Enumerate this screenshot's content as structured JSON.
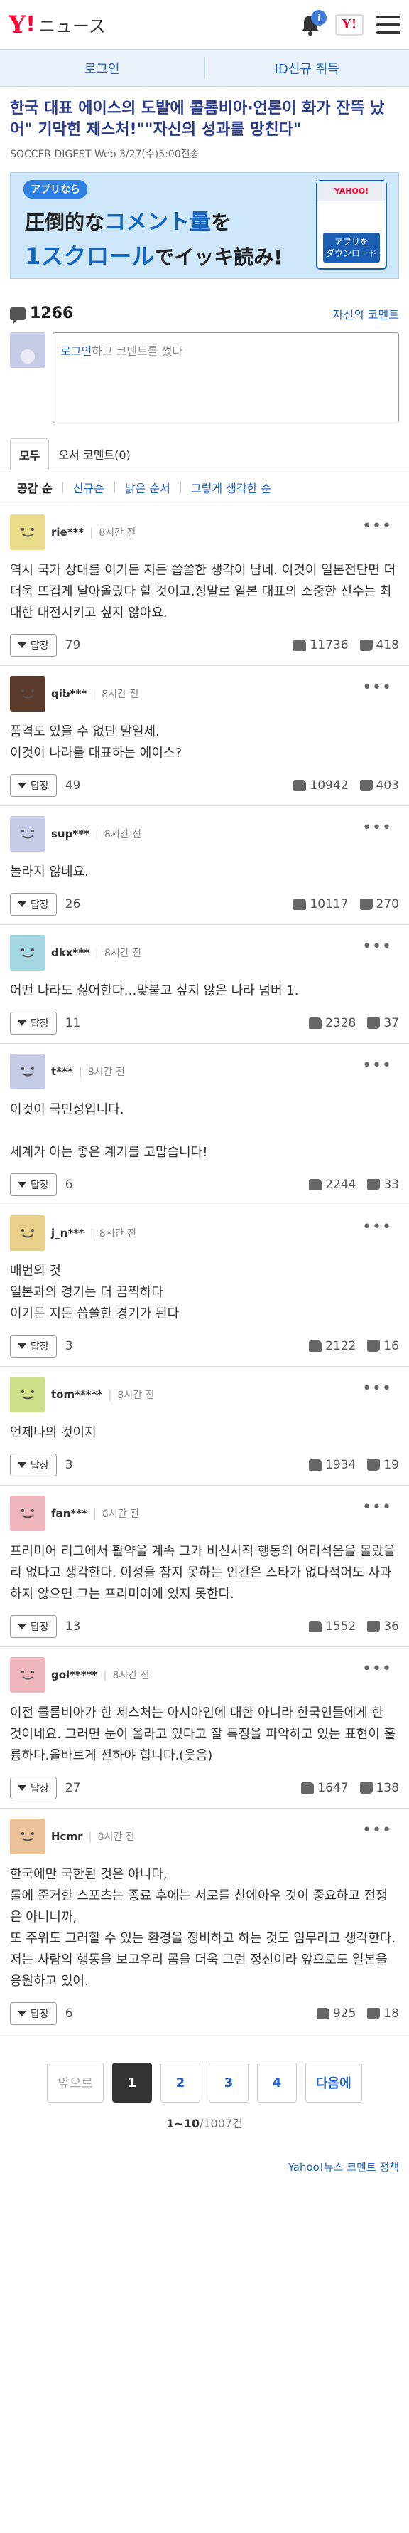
{
  "header": {
    "logo_y": "Y",
    "logo_bang": "!",
    "logo_text": "ニュース",
    "badge": "i",
    "ylogo": "Y!"
  },
  "login_bar": {
    "login": "로그인",
    "signup": "ID신규 취득"
  },
  "article": {
    "title": "한국 대표 에이스의 도발에 콜롬비아·언론이 화가 잔뜩 났어\" 기막힌 제스처!\"\"자신의 성과를 망친다\"",
    "meta": "SOCCER DIGEST Web  3/27(수)5:00전송"
  },
  "banner": {
    "tag": "アプリなら",
    "line1_a": "圧倒的な",
    "line1_b": "コメント量",
    "line1_c": "を",
    "line2_a": "1スクロール",
    "line2_b": "でイッキ読み!",
    "app_button": "アプリを\nダウンロード",
    "app_logo": "YAHOO!"
  },
  "comments_header": {
    "count": "1266",
    "my_comments": "자신의 코멘트"
  },
  "compose": {
    "login_link": "로그인",
    "rest": "하고 코멘트를 썼다"
  },
  "tabs": {
    "all": "모두",
    "expert": "오서 코멘트(0)"
  },
  "sorts": [
    "공감 순",
    "신규순",
    "낡은 순서",
    "그렇게 생각한 순"
  ],
  "reply_label": "답장",
  "comments": [
    {
      "user": "rie***",
      "time": "8시간 전",
      "body": "역시 국가 상대를 이기든 지든 씁쓸한 생각이 남네. 이것이 일본전단면 더더욱 뜨겁게 달아올랐다 할 것이고.정말로 일본 대표의 소중한 선수는 최대한 대전시키고 싶지 않아요.",
      "replies": "79",
      "up": "11736",
      "down": "418",
      "avatar_color": "#e9dc8a"
    },
    {
      "user": "qib***",
      "time": "8시간 전",
      "body": "품격도 있을 수 없단 말일세.\n이것이 나라를 대표하는 에이스?",
      "replies": "49",
      "up": "10942",
      "down": "403",
      "avatar_color": "#5a3a2a"
    },
    {
      "user": "sup***",
      "time": "8시간 전",
      "body": "놀라지 않네요.",
      "replies": "26",
      "up": "10117",
      "down": "270",
      "avatar_color": "#c6cbe6"
    },
    {
      "user": "dkx***",
      "time": "8시간 전",
      "body": "어떤 나라도 싫어한다…맞붙고 싶지 않은 나라 넘버 1.",
      "replies": "11",
      "up": "2328",
      "down": "37",
      "avatar_color": "#a6d8e4"
    },
    {
      "user": "t***",
      "time": "8시간 전",
      "body": "이것이 국민성입니다.\n\n세계가 아는 좋은 계기를 고맙습니다!",
      "replies": "6",
      "up": "2244",
      "down": "33",
      "avatar_color": "#c6cbe6"
    },
    {
      "user": "j_n***",
      "time": "8시간 전",
      "body": "매번의 것\n일본과의 경기는 더 끔찍하다\n이기든 지든 씁쓸한 경기가 된다",
      "replies": "3",
      "up": "2122",
      "down": "16",
      "avatar_color": "#e9d08a"
    },
    {
      "user": "tom*****",
      "time": "8시간 전",
      "body": "언제나의 것이지",
      "replies": "3",
      "up": "1934",
      "down": "19",
      "avatar_color": "#cde08a"
    },
    {
      "user": "fan***",
      "time": "8시간 전",
      "body": "프리미어 리그에서 활약을 계속 그가 비신사적 행동의 어리석음을 몰랐을 리 없다고 생각한다. 이성을 참지 못하는 인간은 스타가 없다적어도 사과하지 않으면 그는 프리미어에 있지 못한다.",
      "replies": "13",
      "up": "1552",
      "down": "36",
      "avatar_color": "#f0b6bd"
    },
    {
      "user": "gol*****",
      "time": "8시간 전",
      "body": "이전 콜롬비아가 한 제스처는 아시아인에 대한 아니라 한국인들에게 한 것이네요. 그러면 눈이 올라고 있다고 잘 특징을 파악하고 있는 표현이 훌륭하다.올바르게 전하야 합니다.(웃음)",
      "replies": "27",
      "up": "1647",
      "down": "138",
      "avatar_color": "#f0b6bd"
    },
    {
      "user": "Hcmr",
      "time": "8시간 전",
      "body": "한국에만 국한된 것은 아니다,\n룰에 준거한 스포츠는 종료 후에는 서로를 찬에아우 것이 중요하고 전쟁은 아니니까,\n또 주위도 그러할 수 있는 환경을 정비하고 하는 것도 임무라고 생각한다.\n저는 사람의 행동을 보고우리 몸을 더욱 그런 정신이라 앞으로도 일본을 응원하고 있어.",
      "replies": "6",
      "up": "925",
      "down": "18",
      "avatar_color": "#ecc29a"
    }
  ],
  "pager": {
    "prev": "앞으로",
    "pages": [
      "1",
      "2",
      "3",
      "4"
    ],
    "next": "다음에",
    "range": "1~10",
    "total": "/1007건"
  },
  "footer": {
    "policy": "Yahoo!뉴스 코멘트 정책"
  }
}
